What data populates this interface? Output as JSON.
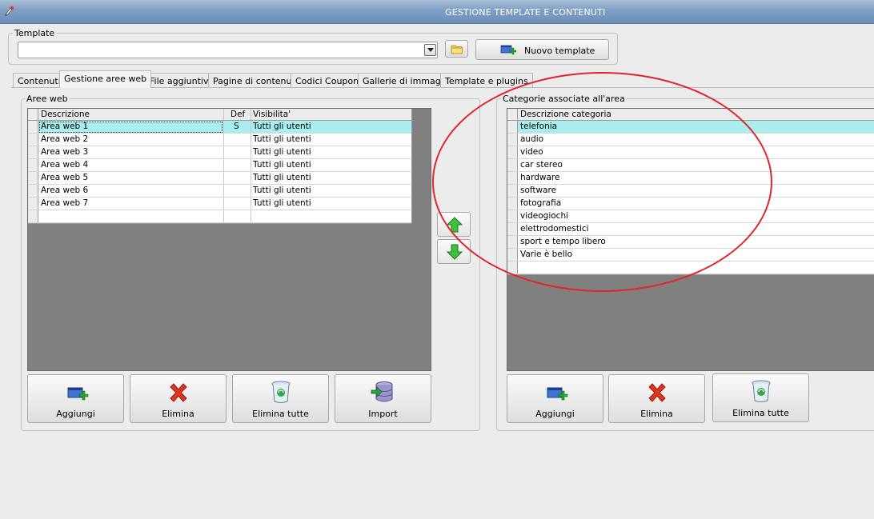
{
  "window": {
    "title": "GESTIONE TEMPLATE E CONTENUTI"
  },
  "template_group": {
    "label": "Template",
    "combo_value": "",
    "new_template_label": "Nuovo template"
  },
  "tabs": [
    {
      "label": "Contenuti",
      "active": false
    },
    {
      "label": "Gestione aree web",
      "active": true
    },
    {
      "label": "File aggiuntivi",
      "active": false
    },
    {
      "label": "Pagine di contenuti",
      "active": false
    },
    {
      "label": "Codici Coupon",
      "active": false
    },
    {
      "label": "Gallerie di immagini",
      "active": false
    },
    {
      "label": "Template e plugins",
      "active": false
    }
  ],
  "aree_web": {
    "label": "Aree web",
    "columns": [
      "Descrizione",
      "Def",
      "Visibilita'"
    ],
    "rows": [
      {
        "descrizione": "Area web 1",
        "def": "S",
        "visibilita": "Tutti gli utenti"
      },
      {
        "descrizione": "Area web 2",
        "def": "",
        "visibilita": "Tutti gli utenti"
      },
      {
        "descrizione": "Area web 3",
        "def": "",
        "visibilita": "Tutti gli utenti"
      },
      {
        "descrizione": "Area web 4",
        "def": "",
        "visibilita": "Tutti gli utenti"
      },
      {
        "descrizione": "Area web 5",
        "def": "",
        "visibilita": "Tutti gli utenti"
      },
      {
        "descrizione": "Area web 6",
        "def": "",
        "visibilita": "Tutti gli utenti"
      },
      {
        "descrizione": "Area web 7",
        "def": "",
        "visibilita": "Tutti gli utenti"
      }
    ],
    "buttons": {
      "add": "Aggiungi",
      "delete": "Elimina",
      "delete_all": "Elimina tutte",
      "import": "Import"
    }
  },
  "categorie": {
    "label": "Categorie associate all'area",
    "column": "Descrizione categoria",
    "rows": [
      "telefonia",
      "audio",
      "video",
      "car stereo",
      "hardware",
      "software",
      "fotografia",
      "videogiochi",
      "elettrodomestici",
      "sport e tempo libero",
      "Varie è bello"
    ],
    "buttons": {
      "add": "Aggiungi",
      "delete": "Elimina",
      "delete_all": "Elimina tutte"
    }
  },
  "colors": {
    "selected_row": "#aaeef0",
    "annotation": "#e0252b",
    "grid_background": "#808080"
  }
}
